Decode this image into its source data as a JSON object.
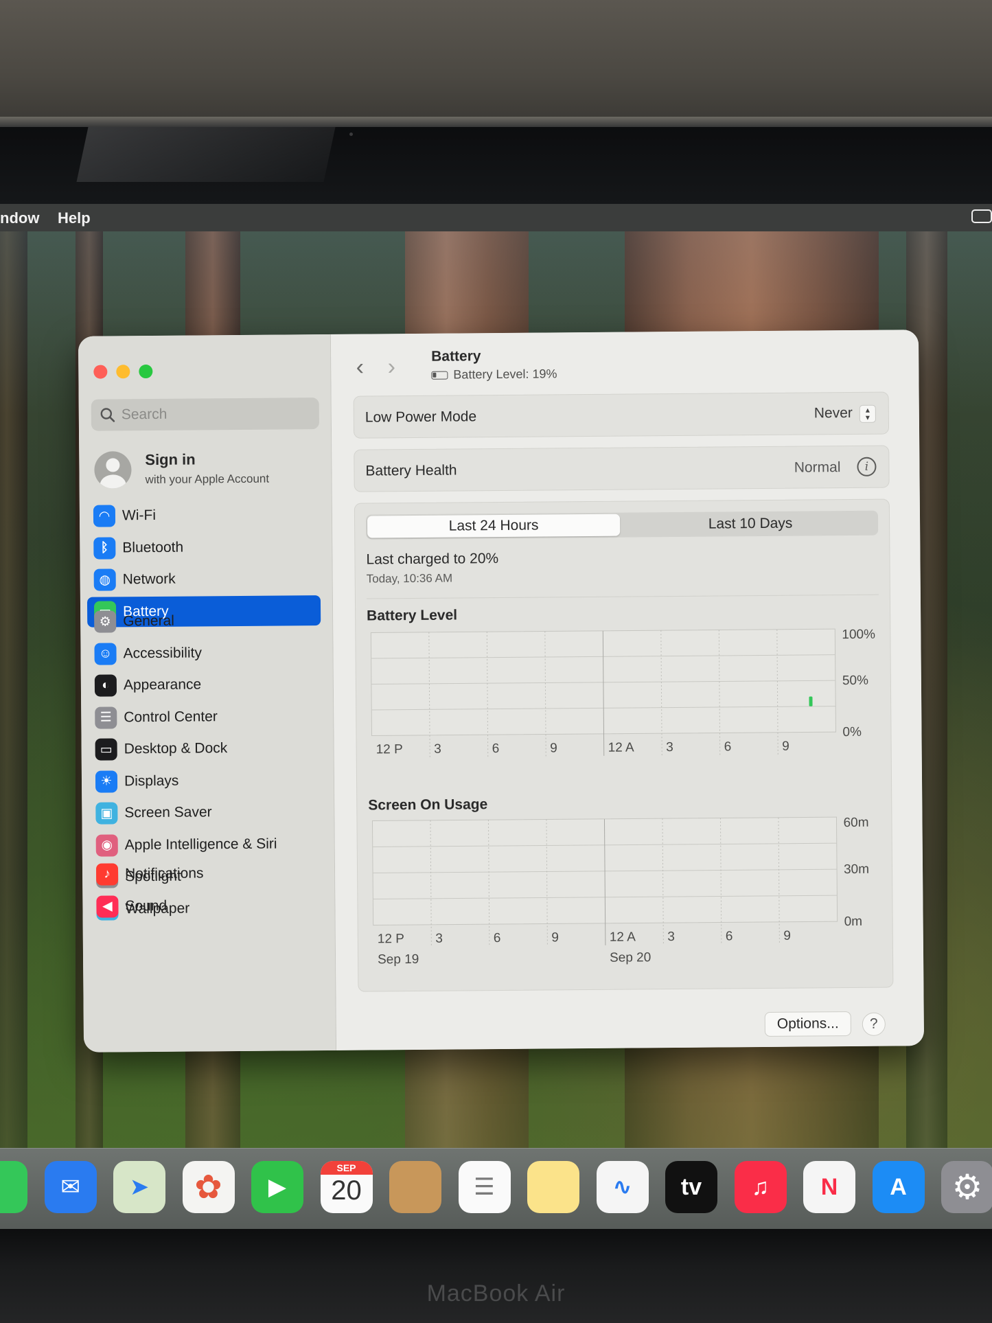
{
  "menubar": {
    "items": [
      "ndow",
      "Help"
    ]
  },
  "sidebar": {
    "search_placeholder": "Search",
    "account": {
      "name": "Sign in",
      "subtitle": "with your Apple Account"
    },
    "group1": [
      {
        "label": "Wi-Fi",
        "icon": "wifi-icon",
        "color": "#1a7cf5"
      },
      {
        "label": "Bluetooth",
        "icon": "bluetooth-icon",
        "color": "#1a7cf5"
      },
      {
        "label": "Network",
        "icon": "globe-icon",
        "color": "#1a7cf5"
      },
      {
        "label": "Battery",
        "icon": "battery-icon",
        "color": "#34c759",
        "selected": true
      }
    ],
    "group2": [
      {
        "label": "General",
        "icon": "gear-icon",
        "color": "#8e8e93"
      },
      {
        "label": "Accessibility",
        "icon": "accessibility-icon",
        "color": "#1a7cf5"
      },
      {
        "label": "Appearance",
        "icon": "appearance-icon",
        "color": "#1c1c1e"
      },
      {
        "label": "Control Center",
        "icon": "control-center-icon",
        "color": "#8e8e93"
      },
      {
        "label": "Desktop & Dock",
        "icon": "dock-icon",
        "color": "#1c1c1e"
      },
      {
        "label": "Displays",
        "icon": "sun-icon",
        "color": "#1a7cf5"
      },
      {
        "label": "Screen Saver",
        "icon": "screen-saver-icon",
        "color": "#3fb2e0"
      },
      {
        "label": "Apple Intelligence & Siri",
        "icon": "siri-icon",
        "color": "#e0607e"
      },
      {
        "label": "Spotlight",
        "icon": "magnifier-icon",
        "color": "#8e8e93"
      },
      {
        "label": "Wallpaper",
        "icon": "flower-icon",
        "color": "#3fb2e0"
      }
    ],
    "group3": [
      {
        "label": "Notifications",
        "icon": "bell-icon",
        "color": "#ff3b30"
      },
      {
        "label": "Sound",
        "icon": "speaker-icon",
        "color": "#ff2d55"
      }
    ]
  },
  "header": {
    "title": "Battery",
    "subtitle": "Battery Level: 19%",
    "back_glyph": "‹",
    "forward_glyph": "›"
  },
  "low_power": {
    "label": "Low Power Mode",
    "value": "Never"
  },
  "battery_health": {
    "label": "Battery Health",
    "value": "Normal"
  },
  "usage": {
    "tabs": [
      "Last 24 Hours",
      "Last 10 Days"
    ],
    "active_tab": 0,
    "last_charged": "Last charged to 20%",
    "last_charged_time": "Today, 10:36 AM"
  },
  "chart_data": [
    {
      "type": "bar",
      "title": "Battery Level",
      "x_tick_labels": [
        "12 P",
        "3",
        "6",
        "9",
        "12 A",
        "3",
        "6",
        "9"
      ],
      "y_tick_labels": [
        "100%",
        "50%",
        "0%"
      ],
      "ylim": [
        0,
        100
      ],
      "bars": [
        {
          "hour_offset": 22.7,
          "value": 19,
          "color": "#34c759"
        }
      ]
    },
    {
      "type": "bar",
      "title": "Screen On Usage",
      "x_tick_labels": [
        "12 P",
        "3",
        "6",
        "9",
        "12 A",
        "3",
        "6",
        "9"
      ],
      "date_labels": [
        {
          "text": "Sep 19",
          "at": "12 P"
        },
        {
          "text": "Sep 20",
          "at": "12 A"
        }
      ],
      "y_tick_labels": [
        "60m",
        "30m",
        "0m"
      ],
      "ylim": [
        0,
        60
      ],
      "bars": []
    }
  ],
  "footer": {
    "options_label": "Options...",
    "help_label": "?"
  },
  "dock": {
    "calendar_month": "SEP",
    "calendar_day": "20",
    "tv_label": "tv",
    "items": [
      {
        "name": "messages-icon",
        "color": "#34c759"
      },
      {
        "name": "mail-icon",
        "color": "#2a7bf0"
      },
      {
        "name": "maps-icon",
        "color": "#d7e6c8"
      },
      {
        "name": "photos-icon",
        "color": "#f4f4f2"
      },
      {
        "name": "facetime-icon",
        "color": "#30c24a"
      },
      {
        "name": "calendar-icon",
        "color": "#fafafa"
      },
      {
        "name": "contacts-icon",
        "color": "#c8975a"
      },
      {
        "name": "reminders-icon",
        "color": "#fafafa"
      },
      {
        "name": "notes-icon",
        "color": "#fbe38a"
      },
      {
        "name": "freeform-icon",
        "color": "#f5f5f5"
      },
      {
        "name": "apple-tv-icon",
        "color": "#111111"
      },
      {
        "name": "music-icon",
        "color": "#fa2d48"
      },
      {
        "name": "news-icon",
        "color": "#f5f5f5"
      },
      {
        "name": "app-store-icon",
        "color": "#1c8cf5"
      },
      {
        "name": "system-settings-icon",
        "color": "#8e8e93"
      }
    ]
  },
  "device_label": "MacBook Air"
}
